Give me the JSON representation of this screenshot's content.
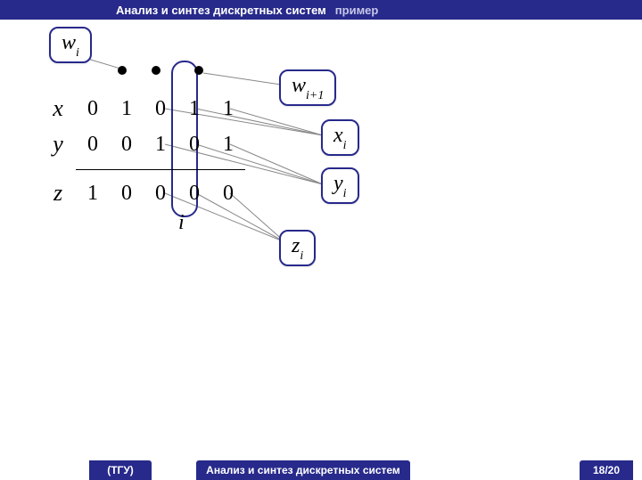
{
  "header": {
    "main": "Анализ и синтез дискретных систем",
    "sub": "пример"
  },
  "footer": {
    "left": "(ТГУ)",
    "center": "Анализ и синтез дискретных систем",
    "right": "18/20"
  },
  "rows": {
    "x": {
      "label": "x",
      "cells": [
        "0",
        "1",
        "0",
        "1",
        "1"
      ]
    },
    "y": {
      "label": "y",
      "cells": [
        "0",
        "0",
        "1",
        "0",
        "1"
      ]
    },
    "z": {
      "label": "z",
      "cells": [
        "1",
        "0",
        "0",
        "0",
        "0"
      ]
    }
  },
  "index_label": "i",
  "bubbles": {
    "wi": {
      "base": "w",
      "sub": "i"
    },
    "wip1": {
      "base": "w",
      "sub": "i+1"
    },
    "xi": {
      "base": "x",
      "sub": "i"
    },
    "yi": {
      "base": "y",
      "sub": "i"
    },
    "zi": {
      "base": "z",
      "sub": "i"
    }
  }
}
